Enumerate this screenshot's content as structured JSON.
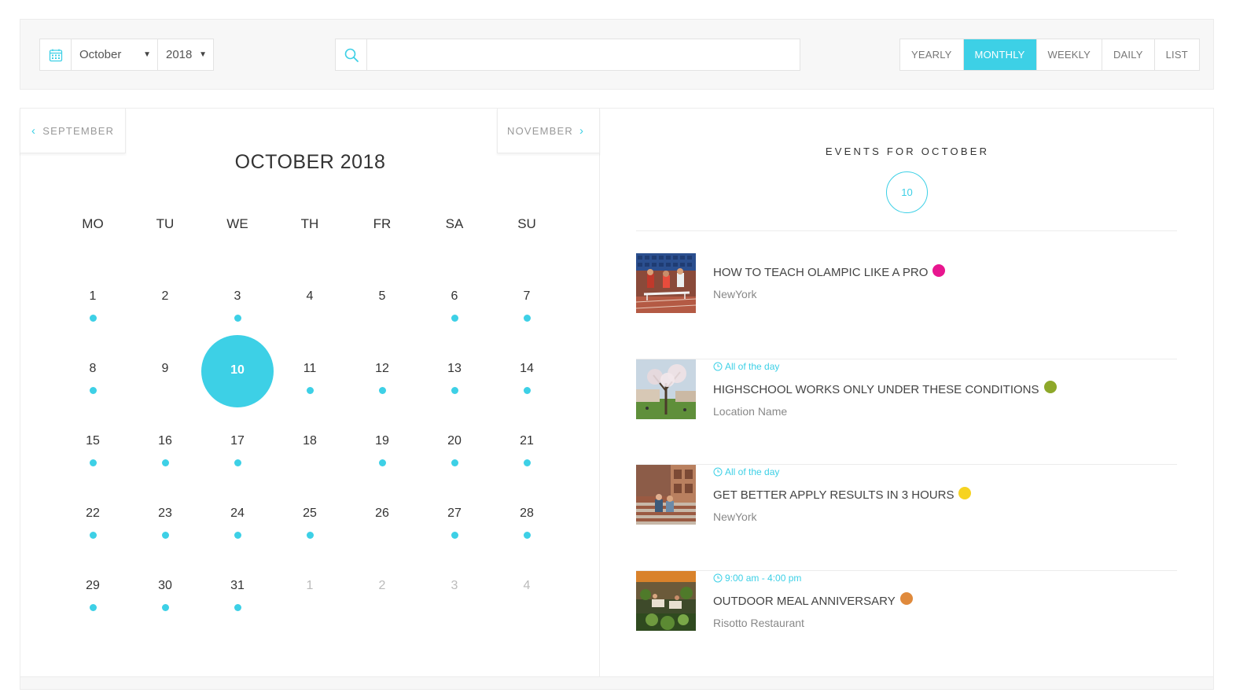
{
  "filter": {
    "month": "October",
    "year": "2018",
    "search_placeholder": "",
    "views": [
      {
        "label": "YEARLY",
        "active": false
      },
      {
        "label": "MONTHLY",
        "active": true
      },
      {
        "label": "WEEKLY",
        "active": false
      },
      {
        "label": "DAILY",
        "active": false
      },
      {
        "label": "LIST",
        "active": false
      }
    ]
  },
  "calendar": {
    "prev_label": "SEPTEMBER",
    "next_label": "NOVEMBER",
    "title": "OCTOBER 2018",
    "weekdays": [
      "MO",
      "TU",
      "WE",
      "TH",
      "FR",
      "SA",
      "SU"
    ],
    "weeks": [
      [
        {
          "d": "1",
          "dot": true
        },
        {
          "d": "2",
          "dot": false
        },
        {
          "d": "3",
          "dot": true
        },
        {
          "d": "4",
          "dot": false
        },
        {
          "d": "5",
          "dot": false
        },
        {
          "d": "6",
          "dot": true
        },
        {
          "d": "7",
          "dot": true
        }
      ],
      [
        {
          "d": "8",
          "dot": true
        },
        {
          "d": "9",
          "dot": false
        },
        {
          "d": "10",
          "dot": false,
          "today": true
        },
        {
          "d": "11",
          "dot": true
        },
        {
          "d": "12",
          "dot": true
        },
        {
          "d": "13",
          "dot": true
        },
        {
          "d": "14",
          "dot": true
        }
      ],
      [
        {
          "d": "15",
          "dot": true
        },
        {
          "d": "16",
          "dot": true
        },
        {
          "d": "17",
          "dot": true
        },
        {
          "d": "18",
          "dot": false
        },
        {
          "d": "19",
          "dot": true
        },
        {
          "d": "20",
          "dot": true
        },
        {
          "d": "21",
          "dot": true
        }
      ],
      [
        {
          "d": "22",
          "dot": true
        },
        {
          "d": "23",
          "dot": true
        },
        {
          "d": "24",
          "dot": true
        },
        {
          "d": "25",
          "dot": true
        },
        {
          "d": "26",
          "dot": false
        },
        {
          "d": "27",
          "dot": true
        },
        {
          "d": "28",
          "dot": true
        }
      ],
      [
        {
          "d": "29",
          "dot": true
        },
        {
          "d": "30",
          "dot": true
        },
        {
          "d": "31",
          "dot": true
        },
        {
          "d": "1",
          "dot": false,
          "other": true
        },
        {
          "d": "2",
          "dot": false,
          "other": true
        },
        {
          "d": "3",
          "dot": false,
          "other": true
        },
        {
          "d": "4",
          "dot": false,
          "other": true
        }
      ]
    ]
  },
  "events": {
    "heading": "EVENTS FOR OCTOBER",
    "count": "10",
    "items": [
      {
        "time": "",
        "title": "HOW TO TEACH OLAMPIC LIKE A PRO",
        "location": "NewYork",
        "color": "#e8168f",
        "thumb": "athletics-photo"
      },
      {
        "time": "All of the day",
        "title": "HIGHSCHOOL WORKS ONLY UNDER THESE CONDITIONS",
        "location": "Location Name",
        "color": "#8ea82a",
        "thumb": "campus-photo"
      },
      {
        "time": "All of the day",
        "title": "GET BETTER APPLY RESULTS IN 3 HOURS",
        "location": "NewYork",
        "color": "#f6d321",
        "thumb": "students-photo"
      },
      {
        "time": "9:00 am - 4:00 pm",
        "title": "OUTDOOR MEAL ANNIVERSARY",
        "location": "Risotto Restaurant",
        "color": "#e08a3c",
        "thumb": "restaurant-photo"
      }
    ]
  },
  "colors": {
    "accent": "#3dd0e6"
  }
}
